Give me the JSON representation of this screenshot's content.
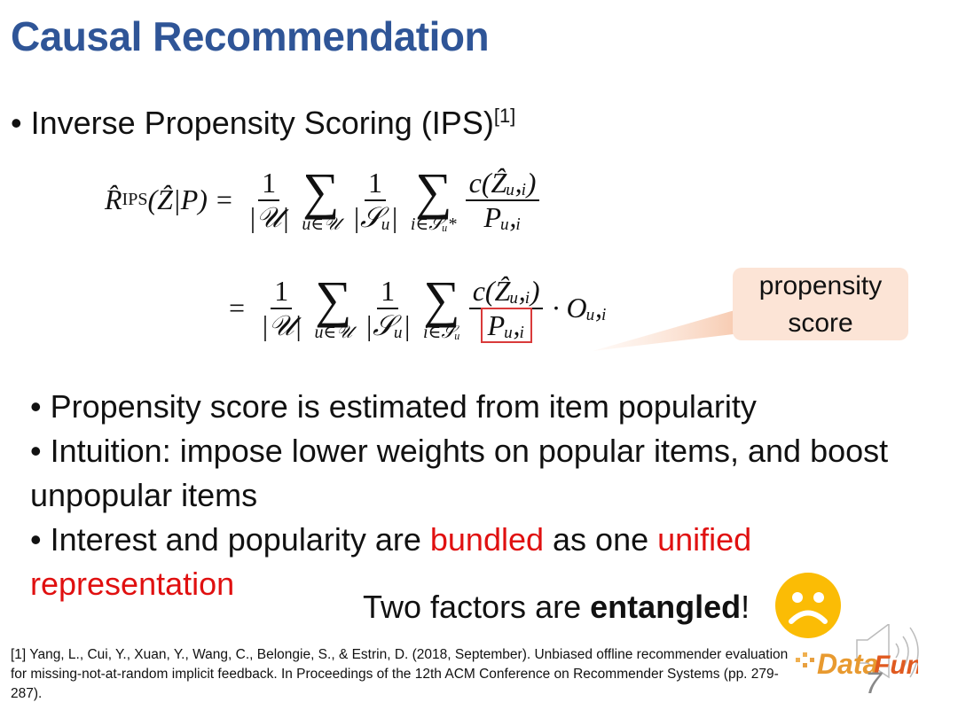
{
  "slide": {
    "title": "Causal Recommendation",
    "main_bullet": "Inverse Propensity Scoring (IPS)",
    "main_bullet_citation": "[1]",
    "formula": {
      "lhs_R": "R̂",
      "lhs_sub": "IPS",
      "lhs_args": "(Ẑ|P)",
      "eq": "=",
      "one": "1",
      "U_den": "|𝒰|",
      "sum_sym": "∑",
      "sum_u_sub": "u∈𝒰",
      "S_den": "|𝒮ᵤ|",
      "sum_i_sub_star": "i∈𝒮ᵤ*",
      "sum_i_sub": "i∈𝒮ᵤ",
      "num": "c(Ẑᵤ,ᵢ)",
      "den": "Pᵤ,ᵢ",
      "obs": "· Oᵤ,ᵢ"
    },
    "callout": {
      "line1": "propensity",
      "line2": "score"
    },
    "bullets": [
      {
        "parts": [
          {
            "text": "• Propensity score is estimated from item popularity",
            "red": false
          }
        ]
      },
      {
        "parts": [
          {
            "text": "• Intuition: impose lower weights on popular items, and boost unpopular items",
            "red": false
          }
        ]
      },
      {
        "parts": [
          {
            "text": "• Interest and popularity are ",
            "red": false
          },
          {
            "text": "bundled",
            "red": true
          },
          {
            "text": " as one ",
            "red": false
          },
          {
            "text": "unified representation",
            "red": true
          }
        ]
      }
    ],
    "entangled": {
      "prefix": "Two factors are ",
      "bold": "entangled",
      "suffix": "!"
    },
    "sad_face_icon": "frowning-face",
    "reference": "[1] Yang, L., Cui, Y., Xuan, Y., Wang, C., Belongie, S., & Estrin, D. (2018, September). Unbiased offline recommender evaluation for missing-not-at-random implicit feedback. In Proceedings of the 12th ACM Conference on Recommender Systems (pp. 279-287).",
    "logo_text": "DataFun.",
    "page_number": "7",
    "colors": {
      "title": "#2F5597",
      "highlight": "#E01010",
      "callout_bg": "#FCE4D6",
      "box": "#D93A3A",
      "face": "#FBBC05"
    }
  }
}
